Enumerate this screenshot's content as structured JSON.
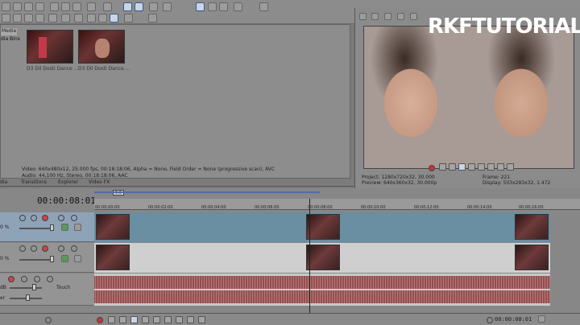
{
  "media": {
    "tab_label": "Media",
    "bins_label": "dia Bins",
    "clips": [
      {
        "label": "D3 Dil Dosti Dance ..."
      },
      {
        "label": "D3 Dil Dosti Dance ..."
      }
    ],
    "info_line1": "Video: 640x480x12, 25.000 fps, 00:18:18:06, Alpha = None, Field Order = None (progressive scan), AVC",
    "info_line2": "Audio: 44,100 Hz, Stereo, 00:18:18:06, AAC"
  },
  "tabs": [
    "dia",
    "Transitions",
    "Explorer",
    "Video FX"
  ],
  "preview": {
    "watermark": "RKFTUTORIALS",
    "project_label": "Project:",
    "project_value": "1280x720x32, 30.000",
    "preview_label": "Preview:",
    "preview_value": "640x360x32, 30.000p",
    "frame_label": "Frame:",
    "frame_value": "221",
    "display_label": "Display:",
    "display_value": "503x283x32, 1.472"
  },
  "timeline": {
    "timecode": "00:00:08:01",
    "marker": "5.0",
    "ruler_labels": [
      "00:00:00:00",
      "00:00:02:00",
      "00:00:04:00",
      "00:00:06:00",
      "00:00:08:00",
      "00:00:10:00",
      "00:00:12:00",
      "00:00:14:00",
      "00:00:16:00"
    ],
    "track1_level": "0 %",
    "track2_level": "0 %",
    "audio_db": "dB",
    "audio_touch": "Touch",
    "audio_label": "er"
  },
  "bottom": {
    "timecode": "00:00:08:01"
  },
  "colors": {
    "selected_track": "#8ea2b8",
    "audio_wave": "#8b3a3a"
  }
}
